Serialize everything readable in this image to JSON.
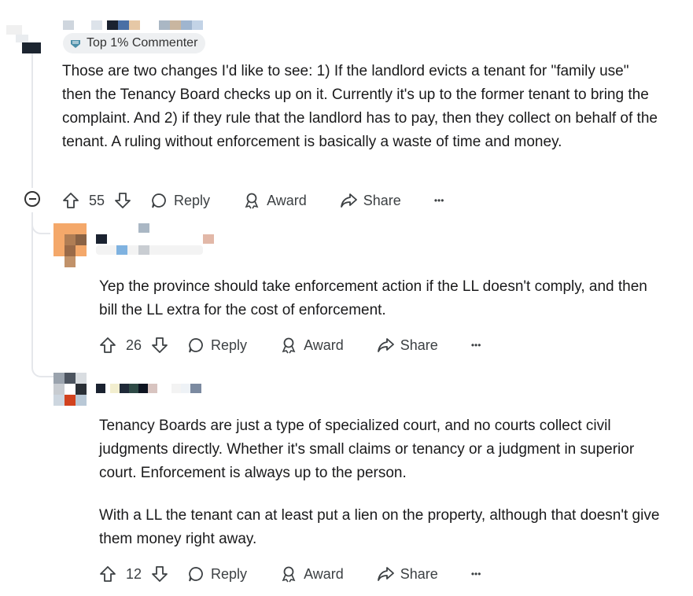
{
  "comment1": {
    "flair": "Top 1% Commenter",
    "body": "Those are two changes I'd like to see: 1) If the landlord evicts a tenant for \"family use\" then the Tenancy Board checks up on it. Currently it's up to the former tenant to bring the complaint. And 2) if they rule that the landlord has to pay, then they collect on behalf of the tenant. A ruling without enforcement is basically a waste of time and money.",
    "votes": "55",
    "reply": "Reply",
    "award": "Award",
    "share": "Share",
    "more": "•••"
  },
  "comment2": {
    "body": "Yep the province should take enforcement action if the LL doesn't comply, and then bill the LL extra for the cost of enforcement.",
    "votes": "26",
    "reply": "Reply",
    "award": "Award",
    "share": "Share",
    "more": "•••"
  },
  "comment3": {
    "body_p1": "Tenancy Boards are just a type of specialized court, and no courts collect civil judgments directly. Whether it's small claims or tenancy or a judgment in superior court. Enforcement is always up to the person.",
    "body_p2": "With a LL the tenant can at least put a lien on the property, although that doesn't give them money right away.",
    "votes": "12",
    "reply": "Reply",
    "award": "Award",
    "share": "Share",
    "more": "•••"
  },
  "colors": {
    "text": "#1a1a1b",
    "flair_bg": "#eef0f2",
    "thread": "#e5e7eb"
  }
}
